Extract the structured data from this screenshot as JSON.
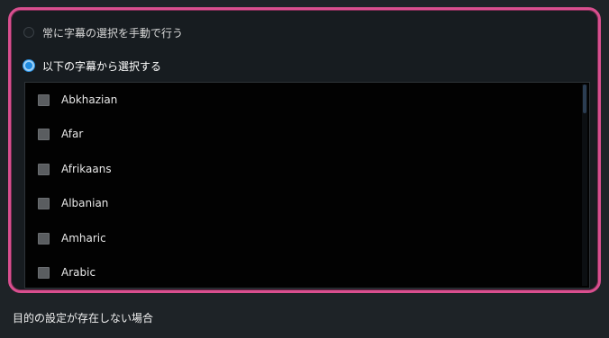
{
  "subtitle_mode": {
    "options": [
      {
        "label": "常に字幕の選択を手動で行う",
        "selected": false
      },
      {
        "label": "以下の字幕から選択する",
        "selected": true
      }
    ]
  },
  "language_list": {
    "items": [
      {
        "label": "Abkhazian",
        "checked": false
      },
      {
        "label": "Afar",
        "checked": false
      },
      {
        "label": "Afrikaans",
        "checked": false
      },
      {
        "label": "Albanian",
        "checked": false
      },
      {
        "label": "Amharic",
        "checked": false
      },
      {
        "label": "Arabic",
        "checked": false
      }
    ]
  },
  "footer": {
    "label": "目的の設定が存在しない場合"
  },
  "colors": {
    "highlight_border": "#d94f8f",
    "radio_selected": "#1f8be0"
  }
}
